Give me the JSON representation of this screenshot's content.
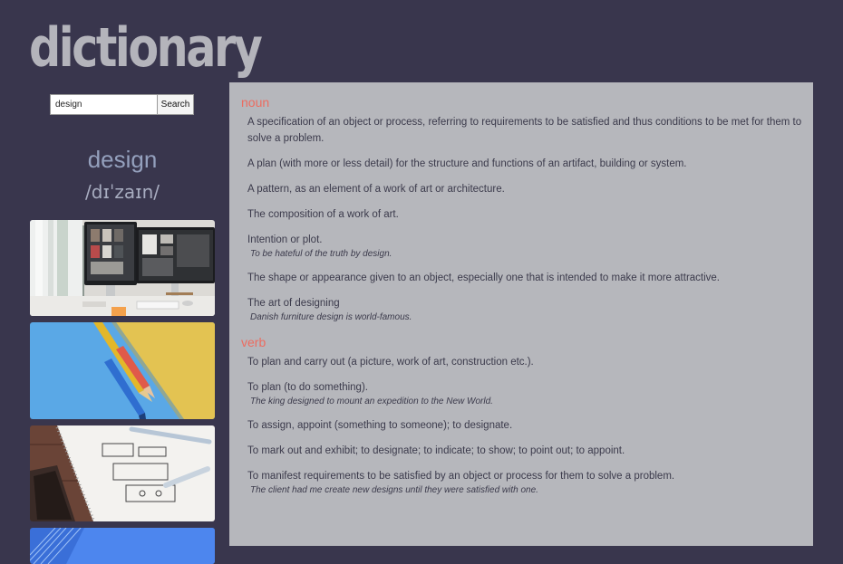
{
  "app": {
    "title": "dictionary"
  },
  "search": {
    "value": "design",
    "button_label": "Search"
  },
  "entry": {
    "word": "design",
    "phonetic": "/dɪˈzaɪn/"
  },
  "images": [
    {
      "icon": "desk-computers-photo"
    },
    {
      "icon": "colored-pencils-photo"
    },
    {
      "icon": "wireframe-sketch-photo"
    },
    {
      "icon": "blue-lines-photo"
    }
  ],
  "meanings": [
    {
      "part_of_speech": "noun",
      "definitions": [
        {
          "text": "A specification of an object or process, referring to requirements to be satisfied and thus conditions to be met for them to solve a problem.",
          "example": ""
        },
        {
          "text": "A plan (with more or less detail) for the structure and functions of an artifact, building or system.",
          "example": ""
        },
        {
          "text": "A pattern, as an element of a work of art or architecture.",
          "example": ""
        },
        {
          "text": "The composition of a work of art.",
          "example": ""
        },
        {
          "text": "Intention or plot.",
          "example": "To be hateful of the truth by design."
        },
        {
          "text": "The shape or appearance given to an object, especially one that is intended to make it more attractive.",
          "example": ""
        },
        {
          "text": "The art of designing",
          "example": "Danish furniture design is world-famous."
        }
      ]
    },
    {
      "part_of_speech": "verb",
      "definitions": [
        {
          "text": "To plan and carry out (a picture, work of art, construction etc.).",
          "example": ""
        },
        {
          "text": "To plan (to do something).",
          "example": "The king designed to mount an expedition to the New World."
        },
        {
          "text": "To assign, appoint (something to someone); to designate.",
          "example": ""
        },
        {
          "text": "To mark out and exhibit; to designate; to indicate; to show; to point out; to appoint.",
          "example": ""
        },
        {
          "text": "To manifest requirements to be satisfied by an object or process for them to solve a problem.",
          "example": "The client had me create new designs until they were satisfied with one."
        }
      ]
    }
  ]
}
